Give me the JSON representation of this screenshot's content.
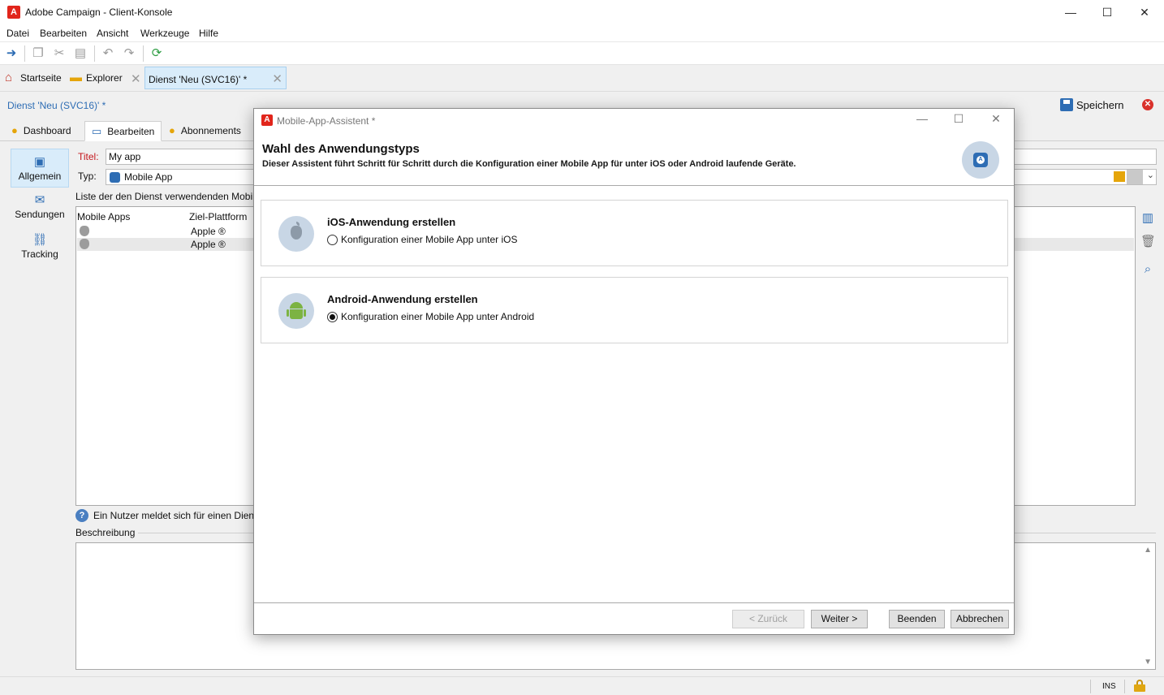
{
  "window": {
    "title": "Adobe Campaign - Client-Konsole",
    "logo_letter": "A",
    "minimize": "—",
    "maximize": "☐",
    "close": "✕"
  },
  "menu": [
    "Datei",
    "Bearbeiten",
    "Ansicht",
    "Werkzeuge",
    "Hilfe"
  ],
  "navbar": {
    "home": "Startseite",
    "explorer": "Explorer",
    "doc_tab": "Dienst  'Neu (SVC16)' *"
  },
  "breadcrumb": "Dienst 'Neu (SVC16)' *",
  "save_label": "Speichern",
  "tabs": [
    "Dashboard",
    "Bearbeiten",
    "Abonnements"
  ],
  "sidebar": [
    "Allgemein",
    "Sendungen",
    "Tracking"
  ],
  "form": {
    "title_label": "Titel:",
    "title_value": "My app",
    "type_label": "Typ:",
    "type_value": "Mobile App",
    "list_caption": "Liste der den Dienst verwendenden Mobile",
    "col_apps": "Mobile Apps",
    "col_platform": "Ziel-Plattform",
    "rows": [
      {
        "platform": "Apple ®"
      },
      {
        "platform": "Apple ®"
      }
    ],
    "help_text": "Ein Nutzer meldet sich für einen Diens",
    "description_label": "Beschreibung"
  },
  "status": {
    "ins": "INS"
  },
  "dialog": {
    "title": "Mobile-App-Assistent *",
    "heading": "Wahl des Anwendungstyps",
    "subheading": "Dieser Assistent führt Schritt für Schritt durch die Konfiguration einer Mobile App für unter iOS oder Android laufende Geräte.",
    "badge_letter": "A",
    "options": [
      {
        "title": "iOS-Anwendung erstellen",
        "radio_label": "Konfiguration einer Mobile App unter iOS",
        "checked": false,
        "icon": "apple-icon"
      },
      {
        "title": "Android-Anwendung erstellen",
        "radio_label": "Konfiguration einer Mobile App unter Android",
        "checked": true,
        "icon": "android-icon"
      }
    ],
    "buttons": {
      "back": "< Zurück",
      "next": "Weiter >",
      "finish": "Beenden",
      "cancel": "Abbrechen"
    }
  },
  "colors": {
    "accent": "#2e6db4",
    "brand_red": "#e1251b",
    "tab_highlight": "#d9ecfa",
    "android_green": "#7cb342"
  }
}
